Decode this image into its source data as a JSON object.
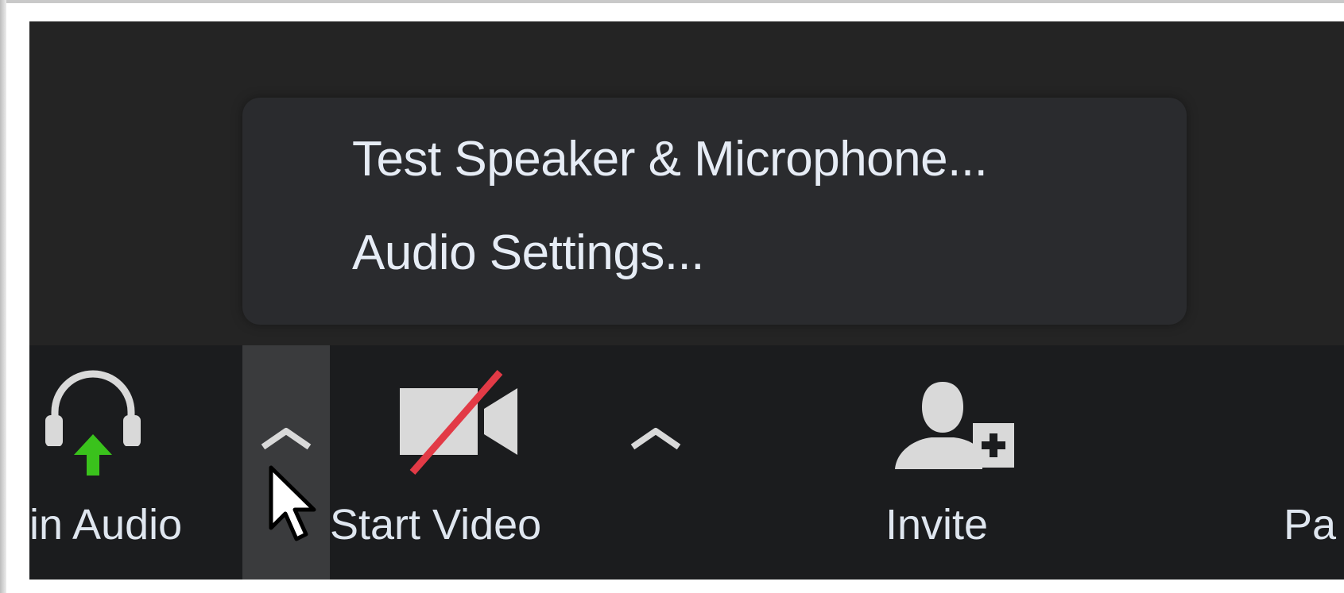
{
  "menu": {
    "items": [
      {
        "label": "Test Speaker & Microphone..."
      },
      {
        "label": "Audio Settings..."
      }
    ]
  },
  "toolbar": {
    "join_audio_label": "in Audio",
    "start_video_label": "Start Video",
    "invite_label": "Invite",
    "participants_label": "Pa"
  },
  "colors": {
    "toolbar_bg": "#1b1c1e",
    "menu_bg": "#2a2b2e",
    "join_arrow": "#3ac21c",
    "video_slash": "#e23a46",
    "active_arrow_bg": "#3a3b3d"
  },
  "icons": {
    "join_audio": "headphones-icon",
    "join_arrow": "arrow-up-icon",
    "audio_options": "chevron-up-icon",
    "start_video": "video-off-icon",
    "video_options": "chevron-up-icon",
    "invite": "add-user-icon",
    "cursor": "mouse-pointer-icon"
  }
}
